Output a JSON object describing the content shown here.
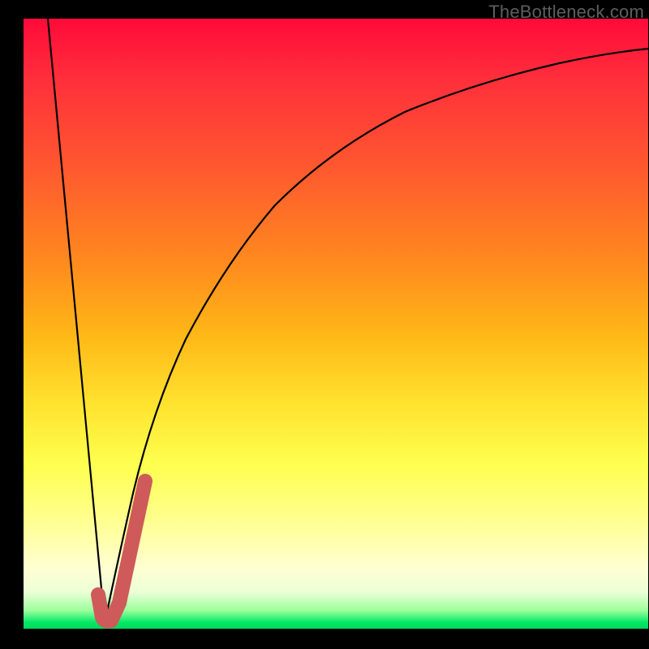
{
  "watermark": "TheBottleneck.com",
  "chart_data": {
    "type": "line",
    "title": "",
    "xlabel": "",
    "ylabel": "",
    "xlim": [
      0,
      100
    ],
    "ylim": [
      0,
      100
    ],
    "series": [
      {
        "name": "left-line",
        "x": [
          4,
          13
        ],
        "y": [
          100,
          1
        ]
      },
      {
        "name": "right-curve",
        "x": [
          13,
          15,
          17.5,
          20,
          25,
          30,
          35,
          40,
          50,
          60,
          70,
          80,
          90,
          100
        ],
        "y": [
          1,
          10,
          22,
          33,
          49,
          60,
          68,
          74,
          82,
          87,
          90,
          92.5,
          94,
          95
        ]
      },
      {
        "name": "red-j-mark",
        "x": [
          12,
          13.2,
          14.5,
          17,
          19.5
        ],
        "y": [
          5,
          1.5,
          1.5,
          12,
          24
        ]
      }
    ],
    "background_gradient": {
      "top": "#ff0a3a",
      "mid": "#ffe22e",
      "bottom": "#00d85e"
    }
  }
}
